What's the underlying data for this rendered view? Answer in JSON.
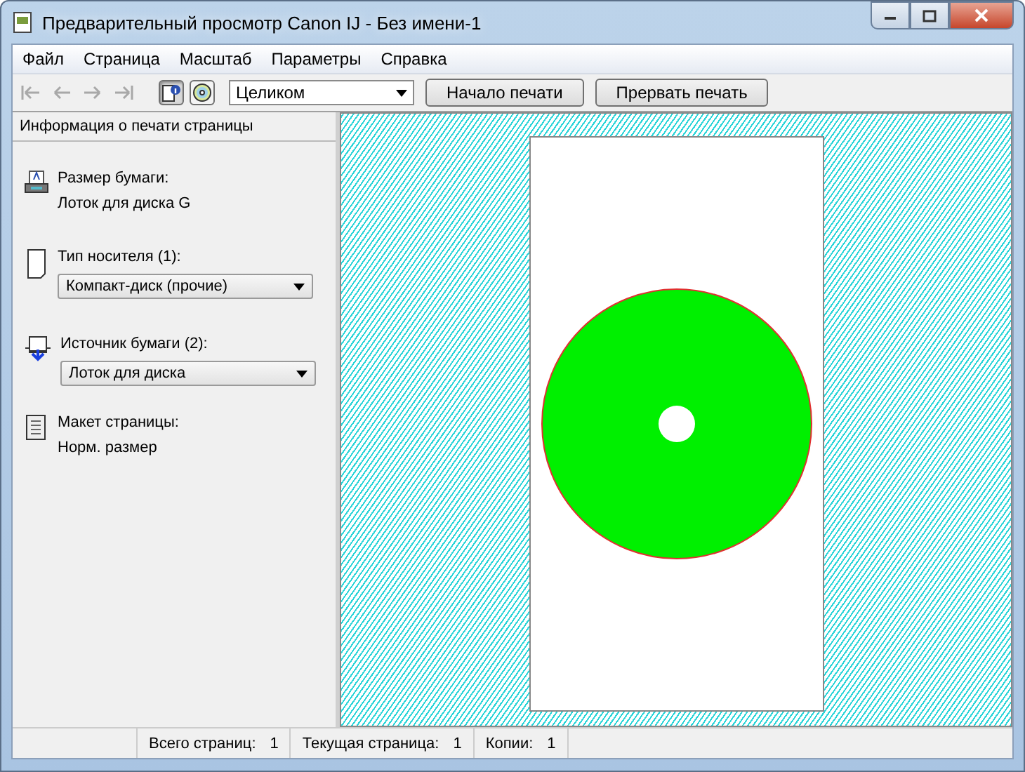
{
  "window": {
    "title": "Предварительный просмотр Canon IJ - Без имени-1"
  },
  "menu": [
    "Файл",
    "Страница",
    "Масштаб",
    "Параметры",
    "Справка"
  ],
  "nav_buttons": [
    {
      "kind": "first",
      "disabled": true
    },
    {
      "kind": "prev",
      "disabled": true
    },
    {
      "kind": "next",
      "disabled": true
    },
    {
      "kind": "last",
      "disabled": true
    }
  ],
  "view_toggles": [
    {
      "kind": "info",
      "selected": true
    },
    {
      "kind": "disc",
      "selected": false
    }
  ],
  "zoom_select": {
    "value": "Целиком"
  },
  "buttons": [
    "Начало печати",
    "Прервать печать"
  ],
  "panel": {
    "title": "Информация о печати страницы",
    "sections": [
      {
        "label": "Размер бумаги:",
        "kind": "text",
        "value": "Лоток для диска G"
      },
      {
        "label": "Тип носителя (1):",
        "kind": "dropdown",
        "value": "Компакт-диск (прочие)"
      },
      {
        "label": "Источник бумаги (2):",
        "kind": "dropdown",
        "value": "Лоток для диска"
      },
      {
        "label": "Макет страницы:",
        "kind": "text",
        "value": "Норм. размер"
      }
    ]
  },
  "preview": {
    "kind": "disc"
  },
  "status_bar": [
    {
      "label": "Всего страниц:",
      "value": "1"
    },
    {
      "label": "Текущая страница:",
      "value": "1"
    },
    {
      "label": "Копии:",
      "value": "1"
    }
  ]
}
